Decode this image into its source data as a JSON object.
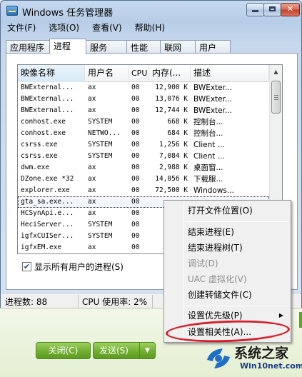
{
  "window": {
    "title": "Windows 任务管理器",
    "controls": {
      "minimize": "minimize",
      "maximize": "maximize",
      "close": "✕"
    }
  },
  "menubar": [
    "文件(F)",
    "选项(O)",
    "查看(V)",
    "帮助(H)"
  ],
  "tabs": [
    {
      "label": "应用程序",
      "active": false
    },
    {
      "label": "进程",
      "active": true
    },
    {
      "label": "服务",
      "active": false
    },
    {
      "label": "性能",
      "active": false
    },
    {
      "label": "联网",
      "active": false
    },
    {
      "label": "用户",
      "active": false
    }
  ],
  "process_table": {
    "columns": [
      "映像名称",
      "用户名",
      "CPU",
      "内存(...",
      "描述"
    ],
    "sorted_column": "映像名称",
    "rows": [
      {
        "name": "BWExternal...",
        "user": "ax",
        "cpu": "00",
        "mem": "12,900 K",
        "desc": "BWExter..."
      },
      {
        "name": "BWExternal...",
        "user": "ax",
        "cpu": "00",
        "mem": "13,076 K",
        "desc": "BWExter..."
      },
      {
        "name": "BWExternal...",
        "user": "ax",
        "cpu": "00",
        "mem": "12,744 K",
        "desc": "BWExter..."
      },
      {
        "name": "conhost.exe",
        "user": "SYSTEM",
        "cpu": "00",
        "mem": "668 K",
        "desc": "控制台..."
      },
      {
        "name": "conhost.exe",
        "user": "NETWO...",
        "cpu": "00",
        "mem": "684 K",
        "desc": "控制台..."
      },
      {
        "name": "csrss.exe",
        "user": "SYSTEM",
        "cpu": "00",
        "mem": "1,256 K",
        "desc": "Client ..."
      },
      {
        "name": "csrss.exe",
        "user": "SYSTEM",
        "cpu": "00",
        "mem": "7,084 K",
        "desc": "Client ..."
      },
      {
        "name": "dwm.exe",
        "user": "ax",
        "cpu": "00",
        "mem": "2,988 K",
        "desc": "桌面窗..."
      },
      {
        "name": "DZone.exe *32",
        "user": "ax",
        "cpu": "00",
        "mem": "14,056 K",
        "desc": "下载服..."
      },
      {
        "name": "explorer.exe",
        "user": "ax",
        "cpu": "00",
        "mem": "72,500 K",
        "desc": "Windows..."
      },
      {
        "name": "gta_sa.exe...",
        "user": "ax",
        "cpu": "00",
        "mem": "",
        "desc": "",
        "selected": true
      },
      {
        "name": "HCSynApi.e...",
        "user": "ax",
        "cpu": "00",
        "mem": "",
        "desc": ""
      },
      {
        "name": "HeciServer...",
        "user": "SYSTEM",
        "cpu": "00",
        "mem": "",
        "desc": ""
      },
      {
        "name": "igfxCUISer...",
        "user": "SYSTEM",
        "cpu": "00",
        "mem": "",
        "desc": ""
      },
      {
        "name": "igfxEM.exe",
        "user": "ax",
        "cpu": "00",
        "mem": "",
        "desc": ""
      }
    ]
  },
  "show_all_users": {
    "label": "显示所有用户的进程(S)",
    "checked": "✔"
  },
  "statusbar": {
    "process_count": "进程数: 88",
    "cpu_usage": "CPU 使用率: 2%"
  },
  "context_menu": {
    "items": [
      {
        "label": "打开文件位置(O)",
        "disabled": false
      },
      {
        "separator": true
      },
      {
        "label": "结束进程(E)",
        "disabled": false
      },
      {
        "label": "结束进程树(T)",
        "disabled": false
      },
      {
        "label": "调试(D)",
        "disabled": true
      },
      {
        "label": "UAC 虚拟化(V)",
        "disabled": true
      },
      {
        "label": "创建转储文件(C)",
        "disabled": false
      },
      {
        "separator": true
      },
      {
        "label": "设置优先级(P)",
        "disabled": false,
        "submenu": "▶"
      },
      {
        "label": "设置相关性(A)...",
        "disabled": false,
        "highlighted_annotation": true
      }
    ]
  },
  "chat_window": {
    "close_button": "关闭(C)",
    "send_button": "发送(S)",
    "send_dropdown": "▼"
  },
  "watermark": {
    "title": "系统之家",
    "url": "Win10net.com"
  },
  "colors": {
    "title_gradient": "#c5d9ef",
    "annotation_ellipse": "#d4202a",
    "chat_button": "#6fae2f",
    "watermark_url": "#1a3e8a"
  }
}
